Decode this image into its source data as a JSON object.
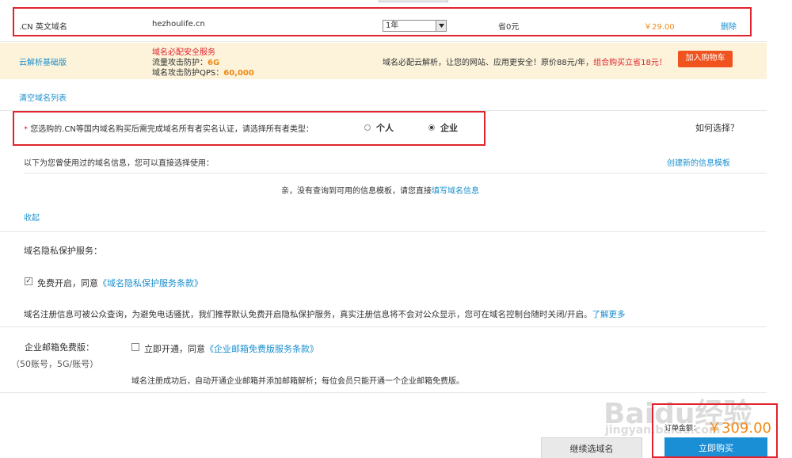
{
  "domain_row": {
    "type_label": ".CN 英文域名",
    "domain_name": "hezhoulife.cn",
    "period_value": "1年",
    "saving": "省0元",
    "price": "￥29.00",
    "delete_label": "删除"
  },
  "promo": {
    "product_label": "云解析基础版",
    "title": "域名必配安全服务",
    "line1_prefix": "流量攻击防护：",
    "line1_value": "6G",
    "line2_prefix": "域名攻击防护QPS：",
    "line2_value": "60,000",
    "description": "域名必配云解析，让您的网站、应用更安全！原价88元/年，",
    "description_highlight": "组合购买立省18元！",
    "add_to_cart_label": "加入购物车"
  },
  "clear_list_label": "清空域名列表",
  "owner": {
    "asterisk": "*",
    "prompt": "您选购的.CN等国内域名购买后需完成域名所有者实名认证，请选择所有者类型：",
    "option_personal": "个人",
    "option_enterprise": "企业",
    "selected": "企业",
    "how_to_choose_label": "如何选择？"
  },
  "templates": {
    "intro": "以下为您曾使用过的域名信息，您可以直接选择使用：",
    "create_new_label": "创建新的信息模板",
    "empty_text": "亲，没有查询到可用的信息模板，请您直接",
    "empty_link": "填写域名信息",
    "collapse_label": "收起"
  },
  "privacy": {
    "heading": "域名隐私保护服务：",
    "checkbox_checked": true,
    "checkbox_label": "免费开启，同意",
    "terms_link": "《域名隐私保护服务条款》",
    "note": "域名注册信息可被公众查询，为避免电话骚扰，我们推荐默认免费开启隐私保护服务，真实注册信息将不会对公众显示，您可在域名控制台随时关闭/开启。",
    "learn_more_label": "了解更多"
  },
  "email": {
    "heading": "企业邮箱免费版：",
    "subheading": "（50账号，5G/账号）",
    "checkbox_checked": false,
    "checkbox_label": "立即开通，同意",
    "terms_link": "《企业邮箱免费版服务条款》",
    "note": "域名注册成功后，自动开通企业邮箱并添加邮箱解析；每位会员只能开通一个企业邮箱免费版。"
  },
  "footer": {
    "total_label": "订单金额：",
    "total_value": "￥309.00",
    "continue_label": "继续选域名",
    "buy_now_label": "立即购买"
  },
  "watermark": {
    "brand": "Baidu经验",
    "url": "jingyan.baidu.com"
  },
  "colors": {
    "accent_blue": "#1a8fce",
    "highlight_red": "#e0232e",
    "price_orange": "#f08a16",
    "promo_bg": "#fcf3da",
    "cart_button": "#f0531e",
    "buy_button": "#1a8fd6"
  }
}
